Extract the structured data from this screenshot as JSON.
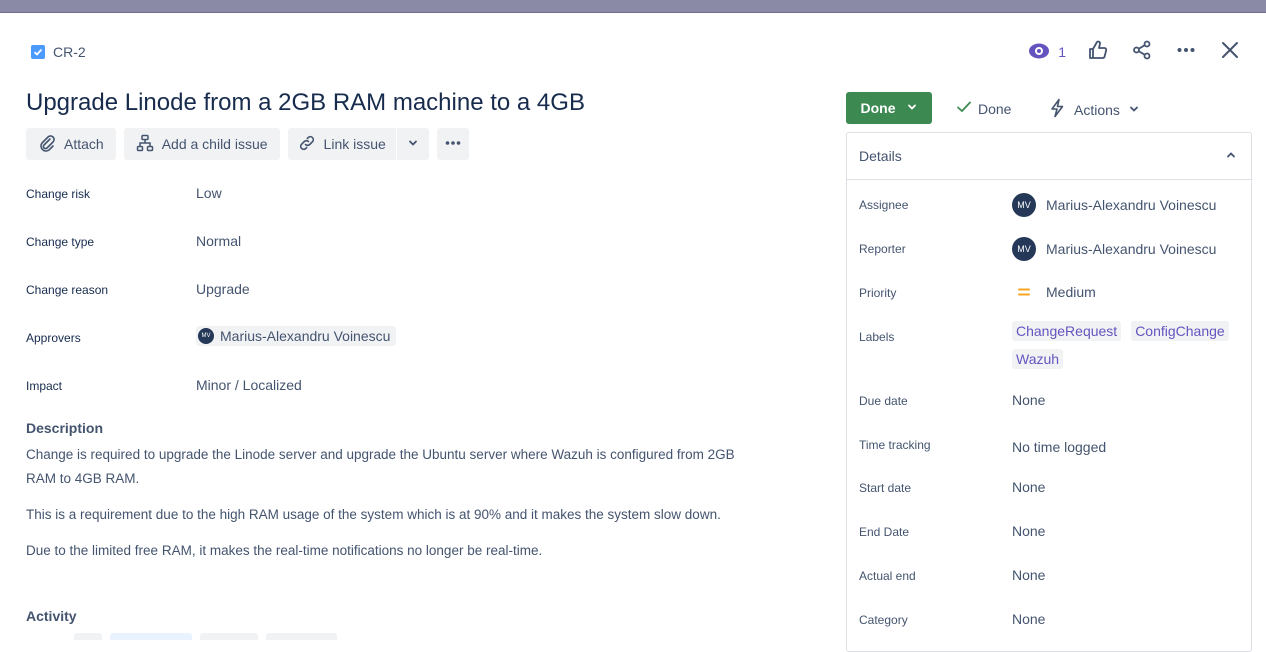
{
  "issue": {
    "key": "CR-2",
    "title": "Upgrade Linode from a 2GB RAM machine to a 4GB"
  },
  "toolbar": {
    "attach": "Attach",
    "add_child": "Add a child issue",
    "link_issue": "Link issue"
  },
  "fields": [
    {
      "label": "Change risk",
      "value": "Low"
    },
    {
      "label": "Change type",
      "value": "Normal"
    },
    {
      "label": "Change reason",
      "value": "Upgrade"
    },
    {
      "label": "Approvers",
      "value": "Marius-Alexandru Voinescu",
      "initials": "MV"
    },
    {
      "label": "Impact",
      "value": "Minor / Localized"
    }
  ],
  "description": {
    "heading": "Description",
    "paragraphs": [
      "Change is required to upgrade the Linode server and upgrade the Ubuntu server where Wazuh is configured from 2GB RAM to 4GB RAM.",
      "This is a requirement due to the high RAM usage of the system which is at 90% and it makes the system slow down.",
      "Due to the limited free RAM, it makes the real-time notifications no longer be real-time."
    ]
  },
  "activity": {
    "heading": "Activity"
  },
  "header_actions": {
    "watchers_count": "1"
  },
  "status": {
    "button": "Done",
    "resolution": "Done",
    "actions": "Actions"
  },
  "details": {
    "heading": "Details",
    "assignee": {
      "label": "Assignee",
      "name": "Marius-Alexandru Voinescu",
      "initials": "MV"
    },
    "reporter": {
      "label": "Reporter",
      "name": "Marius-Alexandru Voinescu",
      "initials": "MV"
    },
    "priority": {
      "label": "Priority",
      "value": "Medium"
    },
    "labels": {
      "label": "Labels",
      "items": [
        "ChangeRequest",
        "ConfigChange",
        "Wazuh"
      ]
    },
    "due_date": {
      "label": "Due date",
      "value": "None"
    },
    "time_tracking": {
      "label": "Time tracking",
      "value": "No time logged"
    },
    "start_date": {
      "label": "Start date",
      "value": "None"
    },
    "end_date": {
      "label": "End Date",
      "value": "None"
    },
    "actual_end": {
      "label": "Actual end",
      "value": "None"
    },
    "category": {
      "label": "Category",
      "value": "None"
    }
  },
  "colors": {
    "status_green": "#3c8a52",
    "watch_purple": "#6554c0",
    "priority_medium": "#f5a623",
    "label_text": "#6554c0"
  }
}
